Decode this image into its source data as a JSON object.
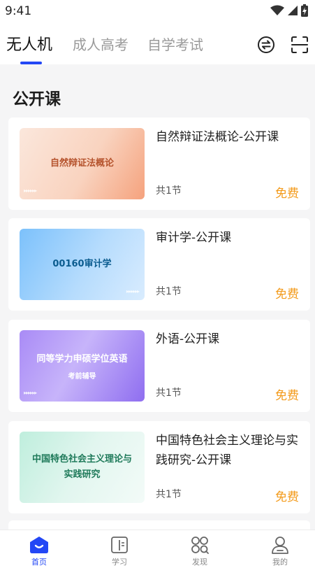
{
  "status_bar": {
    "time": "9:41"
  },
  "tabs": [
    {
      "label": "无人机",
      "active": true
    },
    {
      "label": "成人高考",
      "active": false
    },
    {
      "label": "自学考试",
      "active": false
    }
  ],
  "header_icons": [
    "switch-icon",
    "scan-icon"
  ],
  "section": {
    "title": "公开课"
  },
  "courses": [
    {
      "title": "自然辩证法概论-公开课",
      "count": "共1节",
      "price": "免费",
      "thumb_text": "自然辩证法概论",
      "thumb_sub": ""
    },
    {
      "title": "审计学-公开课",
      "count": "共1节",
      "price": "免费",
      "thumb_text": "00160审计学",
      "thumb_sub": ""
    },
    {
      "title": "外语-公开课",
      "count": "共1节",
      "price": "免费",
      "thumb_text": "同等学力申硕学位英语",
      "thumb_sub": "考前辅导"
    },
    {
      "title": "中国特色社会主义理论与实践研究-公开课",
      "count": "共1节",
      "price": "免费",
      "thumb_text": "中国特色社会主义理论与实践研究",
      "thumb_sub": ""
    }
  ],
  "bottom_nav": [
    {
      "label": "首页",
      "icon": "home-icon",
      "active": true
    },
    {
      "label": "学习",
      "icon": "book-icon",
      "active": false
    },
    {
      "label": "发现",
      "icon": "discover-icon",
      "active": false
    },
    {
      "label": "我的",
      "icon": "user-icon",
      "active": false
    }
  ],
  "colors": {
    "accent": "#2347f5",
    "price": "#f39a1a",
    "background": "#f5f5f6"
  }
}
